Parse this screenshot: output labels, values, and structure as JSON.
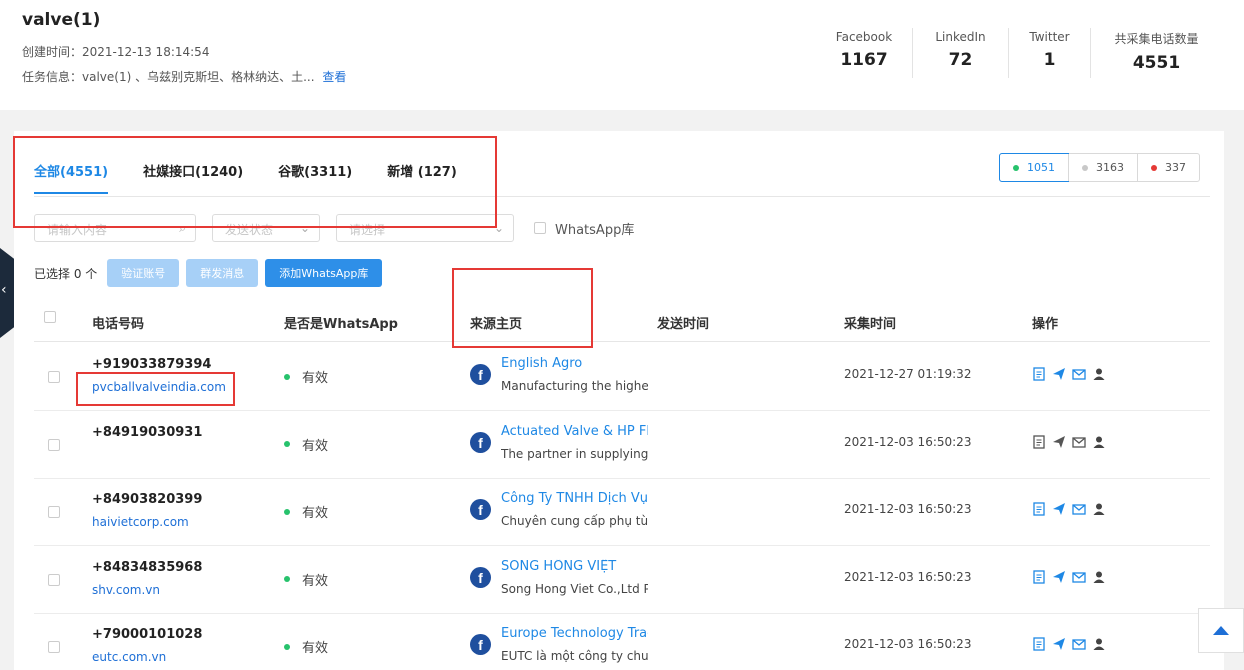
{
  "header": {
    "title": "valve(1)",
    "created": "创建时间：2021-12-13 18:14:54",
    "task_info": "任务信息：valve(1) 、乌兹别克斯坦、格林纳达、土...",
    "view_link": "查看",
    "stats": [
      {
        "label": "Facebook",
        "value": "1167"
      },
      {
        "label": "LinkedIn",
        "value": "72"
      },
      {
        "label": "Twitter",
        "value": "1"
      },
      {
        "label": "共采集电话数量",
        "value": "4551"
      }
    ]
  },
  "tabs": [
    {
      "label": "全部(4551)",
      "active": true
    },
    {
      "label": "社媒接口(1240)",
      "active": false
    },
    {
      "label": "谷歌(3311)",
      "active": false
    },
    {
      "label": "新增 (127)",
      "active": false
    }
  ],
  "status_filter": [
    {
      "label": "1051",
      "color": "#27c26c"
    },
    {
      "label": "3163",
      "color": "#c8c8c8"
    },
    {
      "label": "337",
      "color": "#e53935"
    }
  ],
  "filters": {
    "search_placeholder": "请输入内容",
    "send_status_placeholder": "发送状态",
    "select_placeholder": "请选择",
    "whatsapp_lib_label": "WhatsApp库"
  },
  "actions": {
    "selected": "已选择 0 个",
    "verify": "验证账号",
    "broadcast": "群发消息",
    "add_whatsapp": "添加WhatsApp库"
  },
  "table": {
    "columns": [
      "电话号码",
      "是否是WhatsApp",
      "来源主页",
      "发送时间",
      "采集时间",
      "操作"
    ],
    "rows": [
      {
        "phone": "+919033879394",
        "site": "pvcballvalveindia.com",
        "wa": "有效",
        "src": "English Agro",
        "desc": "Manufacturing the highest",
        "send_time": "",
        "time": "2021-12-27 01:19:32",
        "ops_active": true
      },
      {
        "phone": "+84919030931",
        "site": "",
        "wa": "有效",
        "src": "Actuated Valve & HP Flex",
        "desc": "The partner in supplying A",
        "send_time": "",
        "time": "2021-12-03 16:50:23",
        "ops_active": false
      },
      {
        "phone": "+84903820399",
        "site": "haivietcorp.com",
        "wa": "有效",
        "src": "Công Ty TNHH Dịch Vụ K",
        "desc": "Chuyên cung cấp phụ tùn",
        "send_time": "",
        "time": "2021-12-03 16:50:23",
        "ops_active": true
      },
      {
        "phone": "+84834835968",
        "site": "shv.com.vn",
        "wa": "有效",
        "src": "SÔNG HỒNG VIỆT",
        "desc": "Song Hong Viet Co.,Ltd Pr",
        "send_time": "",
        "time": "2021-12-03 16:50:23",
        "ops_active": true
      },
      {
        "phone": "+79000101028",
        "site": "eutc.com.vn",
        "wa": "有效",
        "src": "Europe Technology Tradin",
        "desc": "EUTC là một công ty chu",
        "send_time": "",
        "time": "2021-12-03 16:50:23",
        "ops_active": true
      }
    ]
  },
  "colors": {
    "accent": "#1e88e5",
    "valid": "#27c26c",
    "highlight": "#e53935"
  }
}
